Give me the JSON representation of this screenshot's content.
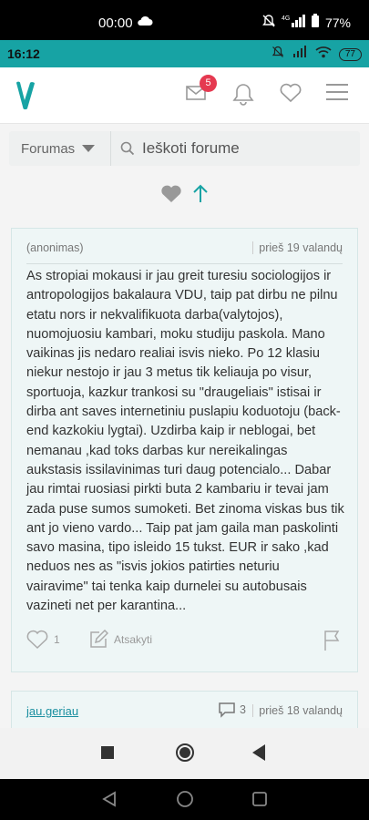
{
  "outer_status": {
    "time": "00:00",
    "network": "4G",
    "battery": "77%"
  },
  "inner_status": {
    "time": "16:12",
    "battery": "77"
  },
  "header": {
    "badge_count": "5"
  },
  "search": {
    "category": "Forumas",
    "placeholder": "Ieškoti forume"
  },
  "posts": [
    {
      "author": "(anonimas)",
      "time": "prieš 19 valandų",
      "text": "As stropiai mokausi ir jau greit turesiu sociologijos ir antropologijos bakalaura VDU, taip pat dirbu ne pilnu etatu nors ir nekvalifikuota darba(valytojos), nuomojuosiu kambari, moku studiju paskola. Mano vaikinas jis nedaro realiai isvis nieko. Po 12 klasiu niekur nestojo ir jau 3 metus tik keliauja po visur, sportuoja, kazkur trankosi su \"draugeliais\" istisai ir dirba ant saves internetiniu puslapiu koduotoju (back-end kazkokiu lygtai). Uzdirba kaip ir neblogai, bet nemanau ,kad toks darbas kur nereikalingas aukstasis issilavinimas turi daug potencialo... Dabar jau rimtai ruosiasi pirkti buta 2 kambariu ir tevai jam zada puse sumos sumoketi. Bet zinoma viskas bus tik ant jo vieno vardo... Taip pat jam gaila man paskolinti savo masina, tipo isleido 15 tukst. EUR ir sako ,kad neduos nes as \"isvis jokios patirties neturiu vairavime\" tai tenka kaip durnelei su autobusais vazineti net per karantina...",
      "likes": "1",
      "reply_label": "Atsakyti"
    },
    {
      "author": "jau.geriau",
      "comments": "3",
      "time": "prieš 18 valandų"
    }
  ],
  "colors": {
    "accent": "#17a3a4",
    "badge": "#e53950"
  }
}
